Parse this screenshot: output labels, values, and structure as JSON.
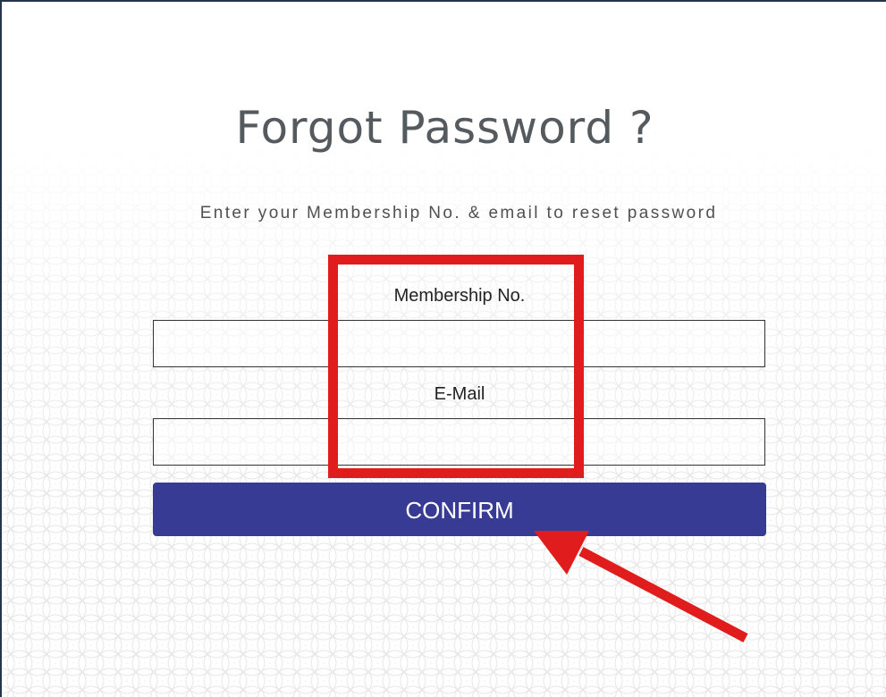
{
  "page": {
    "title": "Forgot Password ?",
    "subtitle": "Enter your Membership No. & email to reset password"
  },
  "form": {
    "membership_label": "Membership No.",
    "membership_value": "",
    "email_label": "E-Mail",
    "email_value": "",
    "confirm_label": "CONFIRM"
  },
  "annotations": {
    "highlight_color": "#e01c1c",
    "arrow_color": "#e01c1c"
  },
  "colors": {
    "button": "#383b93",
    "title_text": "#555a5e"
  }
}
